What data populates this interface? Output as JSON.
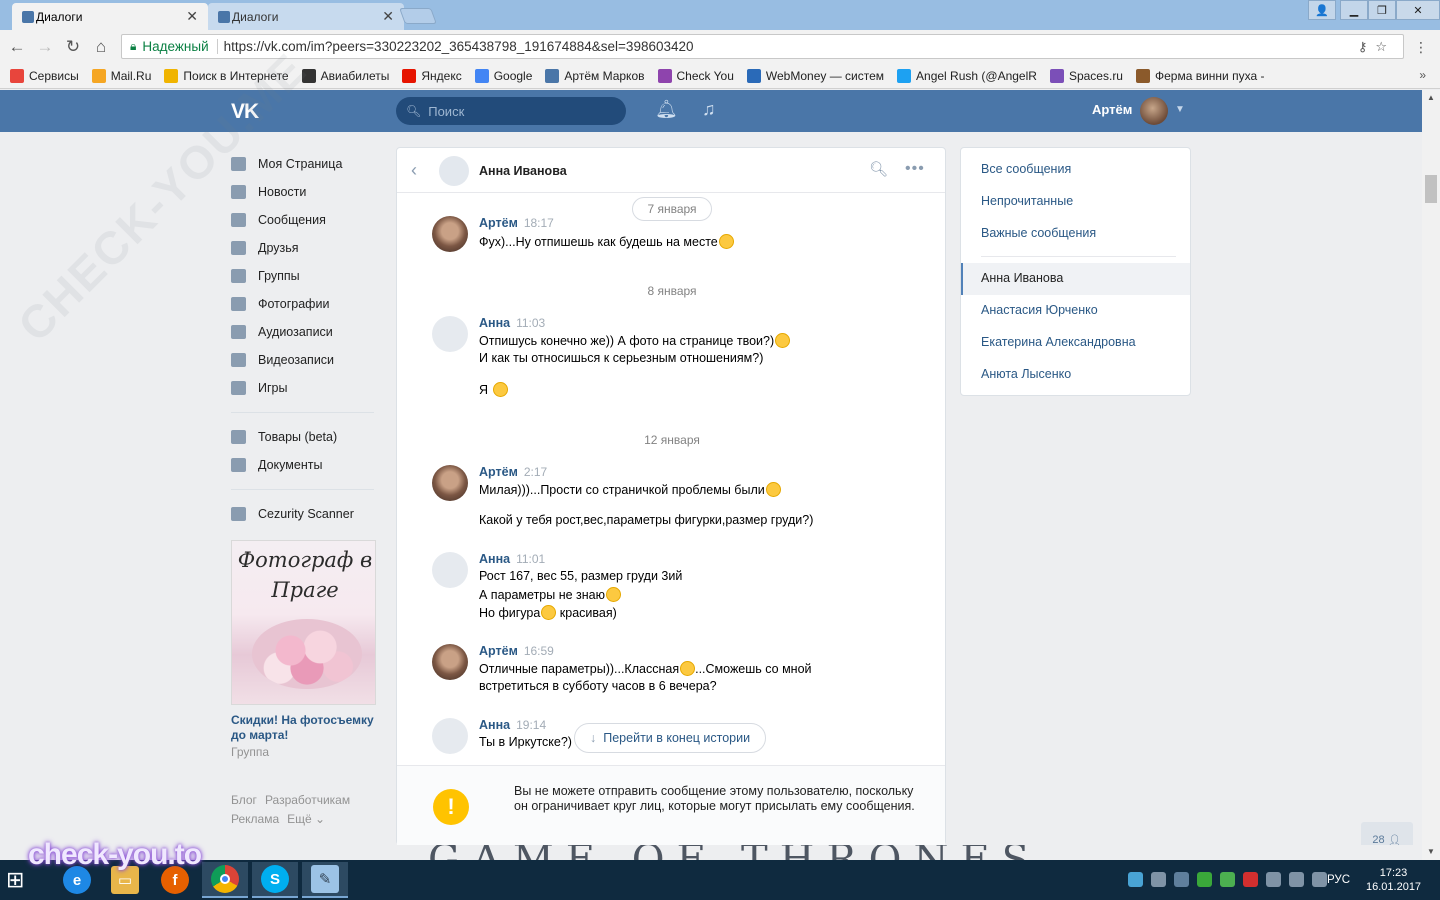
{
  "browser": {
    "tabs": [
      {
        "title": "Диалоги",
        "active": true
      },
      {
        "title": "Диалоги",
        "active": false
      }
    ],
    "secure_label": "Надежный",
    "url": "https://vk.com/im?peers=330223202_365438798_191674884&sel=398603420",
    "bookmarks": [
      {
        "label": "Сервисы",
        "icon": "apps-grid-icon",
        "color": "#e8453c"
      },
      {
        "label": "Mail.Ru",
        "icon": "mailru-icon",
        "color": "#f5a623"
      },
      {
        "label": "Поиск в Интернете",
        "icon": "search-globe-icon",
        "color": "#f0b400"
      },
      {
        "label": "Авиабилеты",
        "icon": "plane-icon",
        "color": "#333333"
      },
      {
        "label": "Яндекс",
        "icon": "yandex-icon",
        "color": "#e61400"
      },
      {
        "label": "Google",
        "icon": "google-icon",
        "color": "#4285f4"
      },
      {
        "label": "Артём Марков",
        "icon": "vk-icon",
        "color": "#4a76a8"
      },
      {
        "label": "Check You",
        "icon": "check-you-icon",
        "color": "#8e44ad"
      },
      {
        "label": "WebMoney — систем",
        "icon": "webmoney-icon",
        "color": "#2a6ab8"
      },
      {
        "label": "Angel Rush (@AngelR",
        "icon": "twitter-icon",
        "color": "#1da1f2"
      },
      {
        "label": "Spaces.ru",
        "icon": "spaces-icon",
        "color": "#7b4fb8"
      },
      {
        "label": "Ферма винни пуха - ",
        "icon": "bear-icon",
        "color": "#8b5a2b"
      }
    ]
  },
  "vk": {
    "search_placeholder": "Поиск",
    "user_name": "Артём",
    "nav": [
      {
        "label": "Моя Страница",
        "icon": "home-icon"
      },
      {
        "label": "Новости",
        "icon": "news-icon"
      },
      {
        "label": "Сообщения",
        "icon": "messages-icon"
      },
      {
        "label": "Друзья",
        "icon": "friends-icon"
      },
      {
        "label": "Группы",
        "icon": "groups-icon"
      },
      {
        "label": "Фотографии",
        "icon": "camera-icon"
      },
      {
        "label": "Аудиозаписи",
        "icon": "music-icon"
      },
      {
        "label": "Видеозаписи",
        "icon": "video-icon"
      },
      {
        "label": "Игры",
        "icon": "gamepad-icon"
      }
    ],
    "nav_extra": [
      {
        "label": "Товары (beta)",
        "icon": "bag-icon"
      },
      {
        "label": "Документы",
        "icon": "document-icon"
      }
    ],
    "nav_apps": [
      {
        "label": "Cezurity Scanner",
        "icon": "apps-icon"
      }
    ],
    "ad": {
      "image_text": "Фотограф в Праге",
      "title": "Скидки! На фотосъемку до марта!",
      "subtitle": "Группа"
    },
    "footer": {
      "blog": "Блог",
      "dev": "Разработчикам",
      "ads": "Реклама",
      "more": "Ещё ⌄"
    },
    "online_count": "28"
  },
  "chat": {
    "partner_name": "Анна Иванова",
    "dates": [
      "7 января",
      "8 января",
      "12 января"
    ],
    "messages": [
      {
        "author": "Артём",
        "time": "18:17",
        "lines": [
          "Фух)...Ну отпишешь как будешь на месте"
        ]
      },
      {
        "author": "Анна",
        "time": "11:03",
        "lines": [
          "Отпишусь конечно же)) А фото на странице твои?)",
          "И как ты относишься к серьезным отношениям?)",
          "Я"
        ]
      },
      {
        "author": "Артём",
        "time": "2:17",
        "lines": [
          "Милая)))...Прости со страничкой проблемы были",
          "Какой у тебя рост,вес,параметры фигурки,размер груди?)"
        ]
      },
      {
        "author": "Анна",
        "time": "11:01",
        "lines": [
          "Рост 167, вес 55, размер груди 3ий",
          "А параметры не знаю",
          "Но фигура",
          "красивая)"
        ]
      },
      {
        "author": "Артём",
        "time": "16:59",
        "lines": [
          "Отличные параметры))...Классная",
          "...Сможешь со мной",
          "встретиться в субботу часов в 6 вечера?"
        ]
      },
      {
        "author": "Анна",
        "time": "19:14",
        "lines": [
          "Ты в Иркутске?)"
        ]
      }
    ],
    "jump_button": "Перейти в конец истории",
    "warning": "Вы не можете отправить сообщение этому пользователю, поскольку он ограничивает круг лиц, которые могут присылать ему сообщения."
  },
  "right_panel": {
    "filters": [
      "Все сообщения",
      "Непрочитанные",
      "Важные сообщения"
    ],
    "dialogs": [
      "Анна Иванова",
      "Анастасия Юрченко",
      "Екатерина Александровна",
      "Анюта Лысенко"
    ],
    "active_dialog": "Анна Иванова"
  },
  "taskbar": {
    "lang": "РУС",
    "time": "17:23",
    "date": "16.01.2017",
    "apps": [
      "internet-explorer-icon",
      "file-explorer-icon",
      "firefox-icon",
      "chrome-icon",
      "skype-icon",
      "notepad-icon"
    ]
  },
  "watermarks": {
    "brand": "check-you.to",
    "diagonal": "CHECK-YOU.ME"
  },
  "wallpaper_text": "GAME OF THRONES"
}
